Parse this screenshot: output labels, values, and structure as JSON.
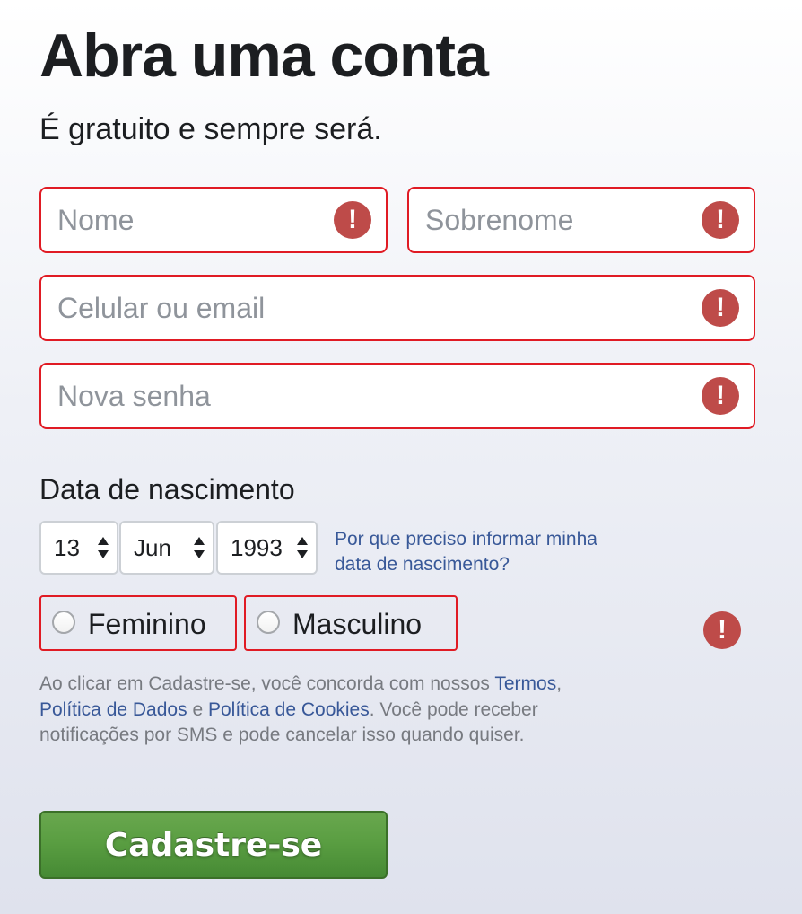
{
  "page": {
    "title": "Abra uma conta",
    "subtitle": "É gratuito e sempre será."
  },
  "form": {
    "first_name": {
      "placeholder": "Nome",
      "value": ""
    },
    "last_name": {
      "placeholder": "Sobrenome",
      "value": ""
    },
    "contact": {
      "placeholder": "Celular ou email",
      "value": ""
    },
    "password": {
      "placeholder": "Nova senha",
      "value": ""
    },
    "error_icon_symbol": "!",
    "error_color": "#be4b49",
    "invalid_border_color": "#e01b24"
  },
  "birthday": {
    "label": "Data de nascimento",
    "day": "13",
    "month": "Jun",
    "year": "1993",
    "help_link": "Por que preciso informar minha data de nascimento?"
  },
  "gender": {
    "options": [
      {
        "label": "Feminino",
        "selected": false
      },
      {
        "label": "Masculino",
        "selected": false
      }
    ]
  },
  "terms": {
    "intro": "Ao clicar em Cadastre-se, você concorda com nossos ",
    "terms_link": "Termos",
    "comma": ", ",
    "data_policy_link": "Política de Dados",
    "and": " e ",
    "cookies_link": "Política de Cookies",
    "outro": ". Você pode receber notificações por SMS e pode cancelar isso quando quiser."
  },
  "submit": {
    "label": "Cadastre-se",
    "color": "#5a9e42"
  },
  "colors": {
    "link": "#385898",
    "text": "#1c1e21",
    "muted": "#777a80"
  },
  "icons": {
    "field_error": "exclamation-circle-icon",
    "select_arrows": "up-down-arrows-icon"
  }
}
